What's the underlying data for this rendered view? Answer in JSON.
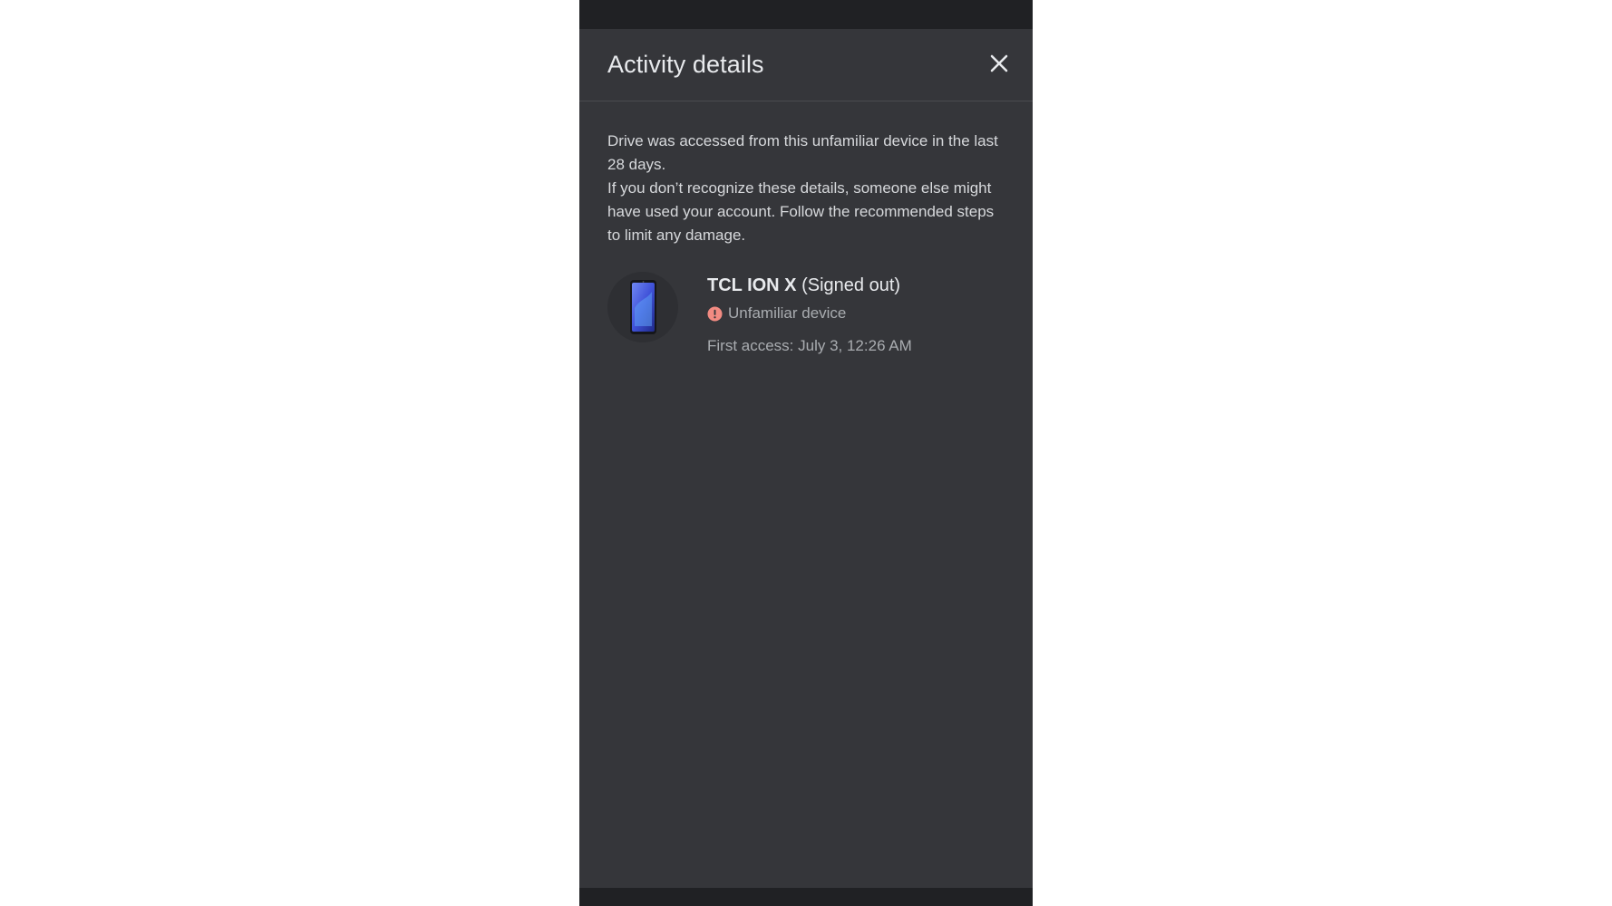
{
  "dialog": {
    "title": "Activity details",
    "close_icon": "close-icon",
    "description_lines": [
      "Drive was accessed from this unfamiliar device in the last 28 days.",
      "If you don’t recognize these details, someone else might have used your account. Follow the recommended steps to limit any damage."
    ]
  },
  "device": {
    "icon": "phone-icon",
    "model": "TCL ION X",
    "state": "(Signed out)",
    "status_icon": "alert-icon",
    "status_text": "Unfamiliar device",
    "first_access": "First access: July 3, 12:26 AM"
  },
  "colors": {
    "background": "#35363a",
    "bars": "#202124",
    "alert": "#f28b82",
    "phone_screen": "#3f51d8"
  }
}
